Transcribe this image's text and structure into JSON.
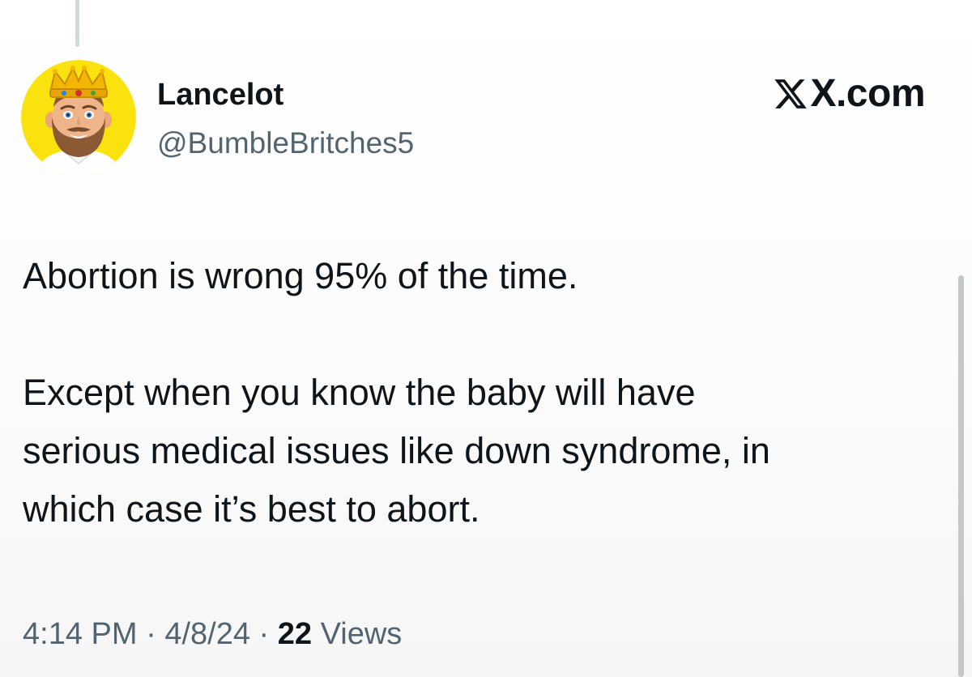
{
  "author": {
    "display_name": "Lancelot",
    "handle": "@BumbleBritches5",
    "avatar_icon": "crowned-bearded-man-avatar"
  },
  "brand": {
    "icon": "x-logo-icon",
    "label": "X.com"
  },
  "tweet": {
    "lines": [
      "Abortion is wrong 95% of the time.",
      "Except when you know the baby will have",
      "serious medical issues like down syndrome, in",
      "which case it’s best to abort."
    ]
  },
  "meta": {
    "time": "4:14 PM",
    "separator": "·",
    "date": "4/8/24",
    "views_count": "22",
    "views_label": "Views"
  },
  "colors": {
    "avatar_background": "#f9e20e",
    "text_primary": "#0f1419",
    "text_secondary": "#536471",
    "thread_line": "#cfd9de"
  }
}
